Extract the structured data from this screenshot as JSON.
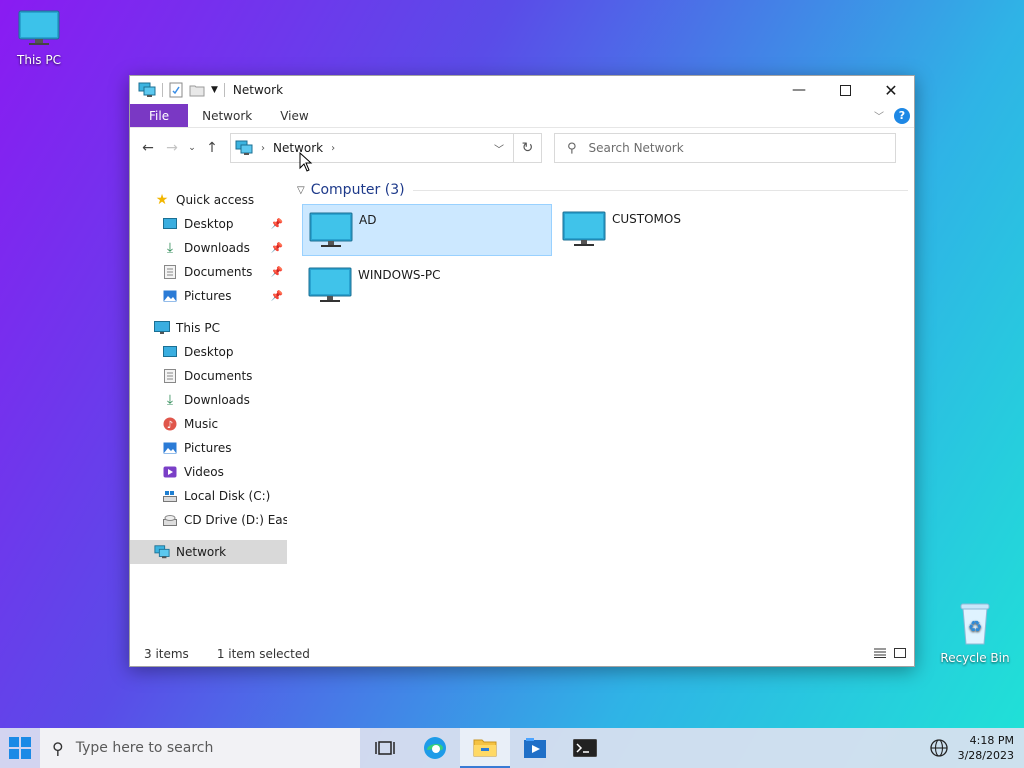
{
  "desktop": {
    "this_pc_label": "This PC",
    "recycle_bin_label": "Recycle Bin"
  },
  "window": {
    "title": "Network",
    "ribbon_tabs": [
      "File",
      "Network",
      "View"
    ],
    "help_label": "?",
    "address": {
      "crumb": "Network"
    },
    "search": {
      "placeholder": "Search Network"
    }
  },
  "nav": {
    "quick_access": {
      "label": "Quick access",
      "items": [
        {
          "label": "Desktop",
          "icon": "desktop-icon",
          "pinned": true
        },
        {
          "label": "Downloads",
          "icon": "downloads-icon",
          "pinned": true
        },
        {
          "label": "Documents",
          "icon": "documents-icon",
          "pinned": true
        },
        {
          "label": "Pictures",
          "icon": "pictures-icon",
          "pinned": true
        }
      ]
    },
    "this_pc": {
      "label": "This PC",
      "items": [
        {
          "label": "Desktop",
          "icon": "desktop-icon"
        },
        {
          "label": "Documents",
          "icon": "documents-icon"
        },
        {
          "label": "Downloads",
          "icon": "downloads-icon"
        },
        {
          "label": "Music",
          "icon": "music-icon"
        },
        {
          "label": "Pictures",
          "icon": "pictures-icon"
        },
        {
          "label": "Videos",
          "icon": "videos-icon"
        },
        {
          "label": "Local Disk (C:)",
          "icon": "drive-icon"
        },
        {
          "label": "CD Drive (D:) EasyKI",
          "icon": "cd-drive-icon"
        }
      ]
    },
    "network": {
      "label": "Network",
      "selected": true
    }
  },
  "content": {
    "group": {
      "label": "Computer (3)"
    },
    "computers": [
      {
        "name": "AD",
        "selected": true
      },
      {
        "name": "CUSTOMOS",
        "selected": false
      },
      {
        "name": "WINDOWS-PC",
        "selected": false
      }
    ]
  },
  "status": {
    "items_count": "3 items",
    "selection": "1 item selected"
  },
  "taskbar": {
    "search_placeholder": "Type here to search",
    "time": "4:18 PM",
    "date": "3/28/2023"
  },
  "colors": {
    "accent": "#7a38c4",
    "selection": "#cce8ff",
    "monitor": "#29a3d1"
  }
}
